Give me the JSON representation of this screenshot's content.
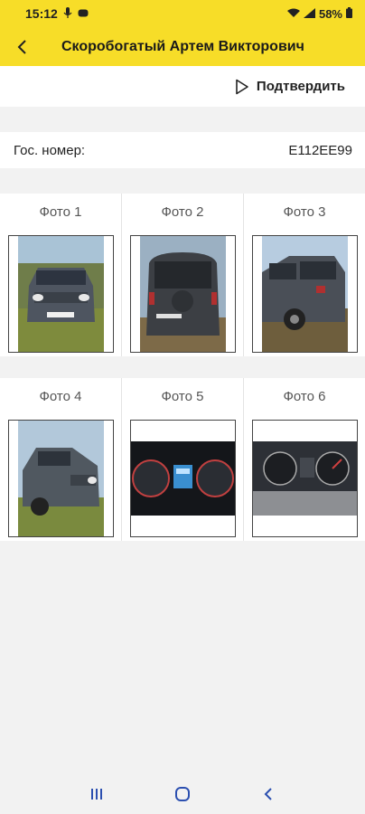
{
  "status": {
    "time": "15:12",
    "battery": "58%",
    "icons": [
      "microphone-icon",
      "cast-icon",
      "wifi-icon",
      "signal-icon",
      "battery-icon"
    ]
  },
  "header": {
    "title": "Скоробогатый Артем Викторович",
    "back_icon": "chevron-left-icon",
    "background": "#f7dd28"
  },
  "toolbar": {
    "confirm_label": "Подтвердить",
    "confirm_icon": "play-outline-icon"
  },
  "vehicle": {
    "plate_label": "Гос. номер:",
    "plate_value": "Е112ЕЕ99"
  },
  "photos": [
    {
      "label": "Фото 1",
      "subject": "car-front"
    },
    {
      "label": "Фото 2",
      "subject": "car-rear"
    },
    {
      "label": "Фото 3",
      "subject": "car-side"
    },
    {
      "label": "Фото 4",
      "subject": "car-front-left"
    },
    {
      "label": "Фото 5",
      "subject": "dashboard"
    },
    {
      "label": "Фото 6",
      "subject": "instrument-cluster"
    }
  ],
  "navbar": {
    "icons": [
      "recent-apps-icon",
      "home-icon",
      "back-icon"
    ]
  }
}
